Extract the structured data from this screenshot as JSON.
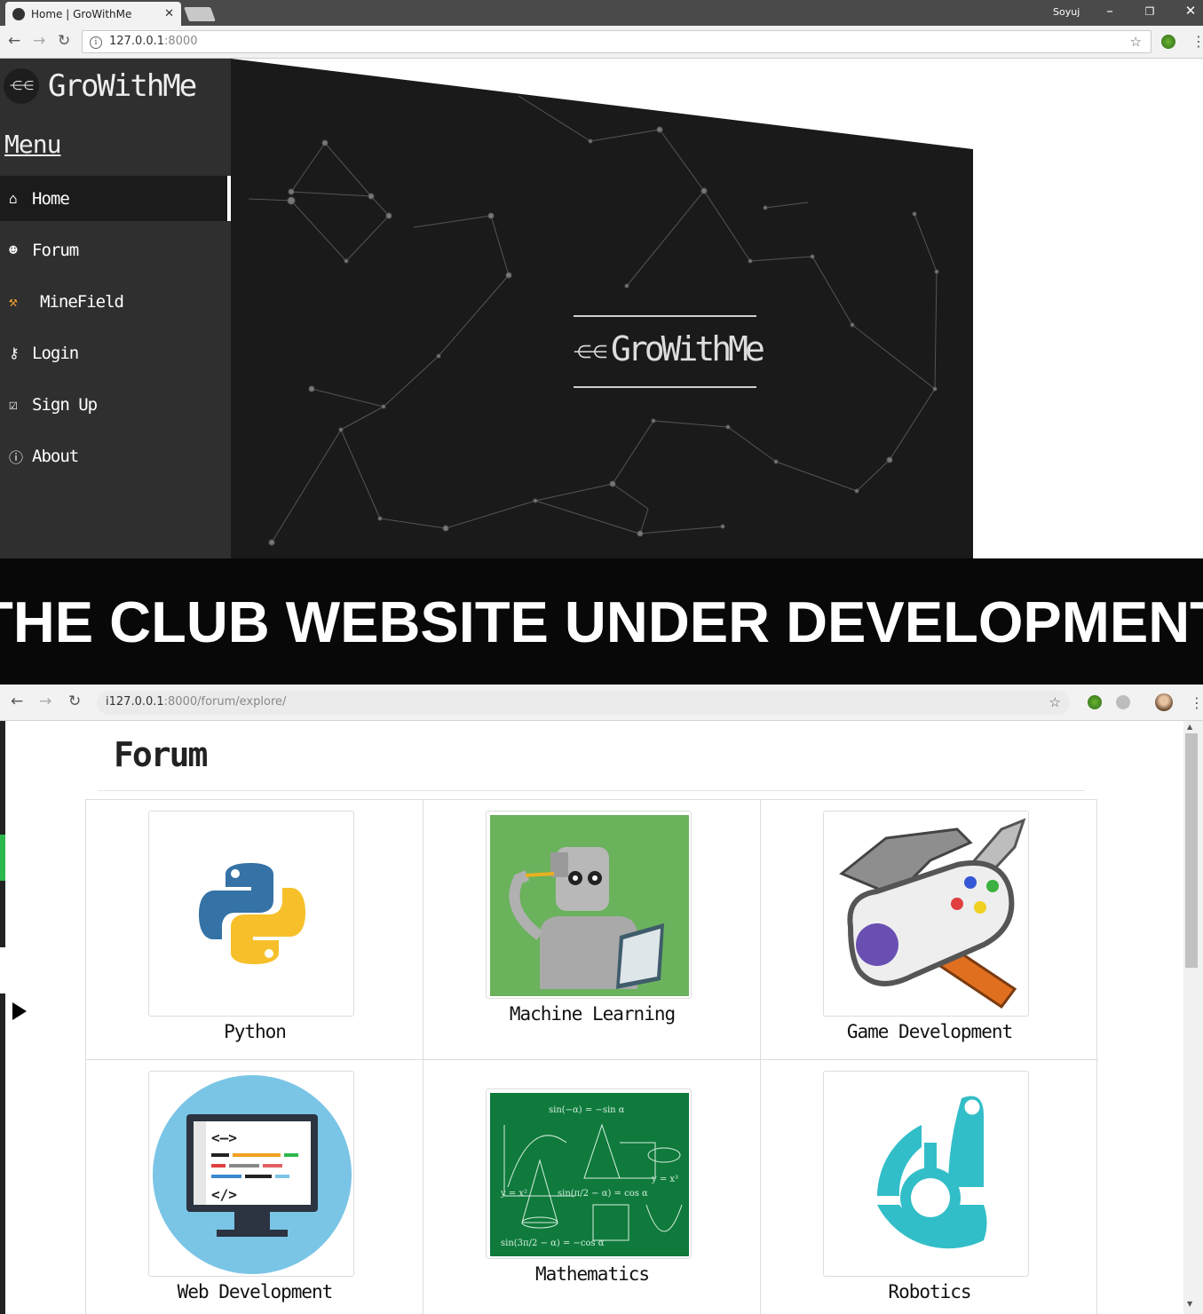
{
  "browser1": {
    "tab_title": "Home | GroWithMe",
    "user": "Soyuj",
    "url_host": "127.0.0.1",
    "url_port": ":8000"
  },
  "sidebar": {
    "brand": "GroWithMe",
    "menu_heading": "Menu",
    "items": [
      {
        "label": "Home",
        "icon": "home-icon"
      },
      {
        "label": "Forum",
        "icon": "user-icon"
      },
      {
        "label": "MineField",
        "icon": "pickaxe-icon"
      },
      {
        "label": "Login",
        "icon": "key-icon"
      },
      {
        "label": "Sign Up",
        "icon": "clipboard-check-icon"
      },
      {
        "label": "About",
        "icon": "info-icon"
      }
    ]
  },
  "hero": {
    "logo_text": "GroWithMe"
  },
  "banner": {
    "text": "THE CLUB WEBSITE UNDER DEVELOPMENT"
  },
  "browser2": {
    "url_host": "127.0.0.1",
    "url_rest": ":8000/forum/explore/"
  },
  "forum": {
    "title": "Forum",
    "categories": [
      {
        "label": "Python",
        "icon": "python-logo-icon"
      },
      {
        "label": "Machine Learning",
        "icon": "robot-reading-icon"
      },
      {
        "label": "Game Development",
        "icon": "gamepad-hammer-icon"
      },
      {
        "label": "Web Development",
        "icon": "code-monitor-icon"
      },
      {
        "label": "Mathematics",
        "icon": "chalkboard-formulas-icon"
      },
      {
        "label": "Robotics",
        "icon": "robotics-logo-icon"
      }
    ]
  }
}
